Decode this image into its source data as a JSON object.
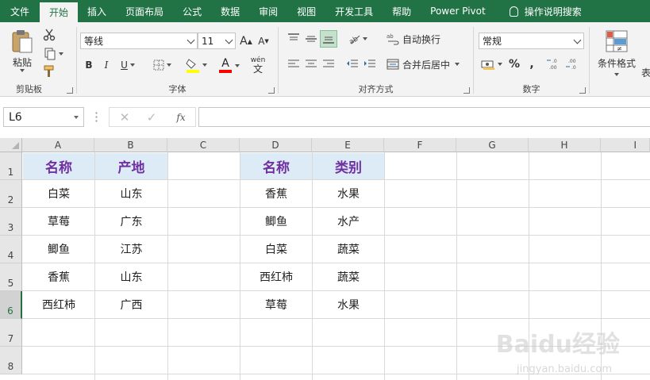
{
  "tabs": [
    {
      "label": "文件",
      "active": false
    },
    {
      "label": "开始",
      "active": true
    },
    {
      "label": "插入",
      "active": false
    },
    {
      "label": "页面布局",
      "active": false
    },
    {
      "label": "公式",
      "active": false
    },
    {
      "label": "数据",
      "active": false
    },
    {
      "label": "审阅",
      "active": false
    },
    {
      "label": "视图",
      "active": false
    },
    {
      "label": "开发工具",
      "active": false
    },
    {
      "label": "帮助",
      "active": false
    },
    {
      "label": "Power Pivot",
      "active": false
    }
  ],
  "tell_me": "操作说明搜索",
  "ribbon": {
    "clipboard": {
      "label": "剪贴板",
      "paste": "粘贴"
    },
    "font": {
      "label": "字体",
      "font_name": "等线",
      "font_size": "11",
      "bold": "B",
      "italic": "I",
      "underline": "U",
      "font_color_letter": "A",
      "grow": "A",
      "shrink": "A",
      "phonetic": "wén"
    },
    "alignment": {
      "label": "对齐方式",
      "wrap_text": "自动换行",
      "merge_center": "合并后居中"
    },
    "number": {
      "label": "数字",
      "format": "常规",
      "percent": "%",
      "comma": ","
    },
    "styles": {
      "conditional_format": "条件格式",
      "table_partial": "表"
    }
  },
  "formula_bar": {
    "name_box": "L6",
    "formula": ""
  },
  "columns": [
    "A",
    "B",
    "C",
    "D",
    "E",
    "F",
    "G",
    "H",
    "I"
  ],
  "rows": [
    "1",
    "2",
    "3",
    "4",
    "5",
    "6",
    "7",
    "8"
  ],
  "active_row": "6",
  "table1": {
    "headers": [
      "名称",
      "产地"
    ],
    "rows": [
      [
        "白菜",
        "山东"
      ],
      [
        "草莓",
        "广东"
      ],
      [
        "鲫鱼",
        "江苏"
      ],
      [
        "香蕉",
        "山东"
      ],
      [
        "西红柿",
        "广西"
      ]
    ]
  },
  "table2": {
    "headers": [
      "名称",
      "类别"
    ],
    "rows": [
      [
        "香蕉",
        "水果"
      ],
      [
        "鲫鱼",
        "水产"
      ],
      [
        "白菜",
        "蔬菜"
      ],
      [
        "西红柿",
        "蔬菜"
      ],
      [
        "草莓",
        "水果"
      ]
    ]
  },
  "watermark": {
    "brand": "Baidu经验",
    "url": "jingyan.baidu.com"
  },
  "colors": {
    "excel_green": "#217346",
    "header_fill": "#ddebf7",
    "header_text": "#7030a0"
  }
}
